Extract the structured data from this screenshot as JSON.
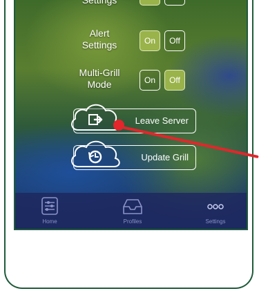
{
  "settings": {
    "top_partial_label": "Settings",
    "alert": {
      "label_line1": "Alert",
      "label_line2": "Settings",
      "on_label": "On",
      "off_label": "Off",
      "selected": "on"
    },
    "multi_grill": {
      "label_line1": "Multi-Grill",
      "label_line2": "Mode",
      "on_label": "On",
      "off_label": "Off",
      "selected": "off"
    },
    "leave_server_label": "Leave Server",
    "update_grill_label": "Update Grill"
  },
  "tabbar": {
    "home_label": "Home",
    "profiles_label": "Profiles",
    "settings_label": "Settings",
    "active_tab": "settings"
  },
  "colors": {
    "frame_border": "#1e5a3a",
    "toggle_active": "#9ab34a",
    "pointer": "#e2262b",
    "tabbar_bg": "#1e285f"
  }
}
